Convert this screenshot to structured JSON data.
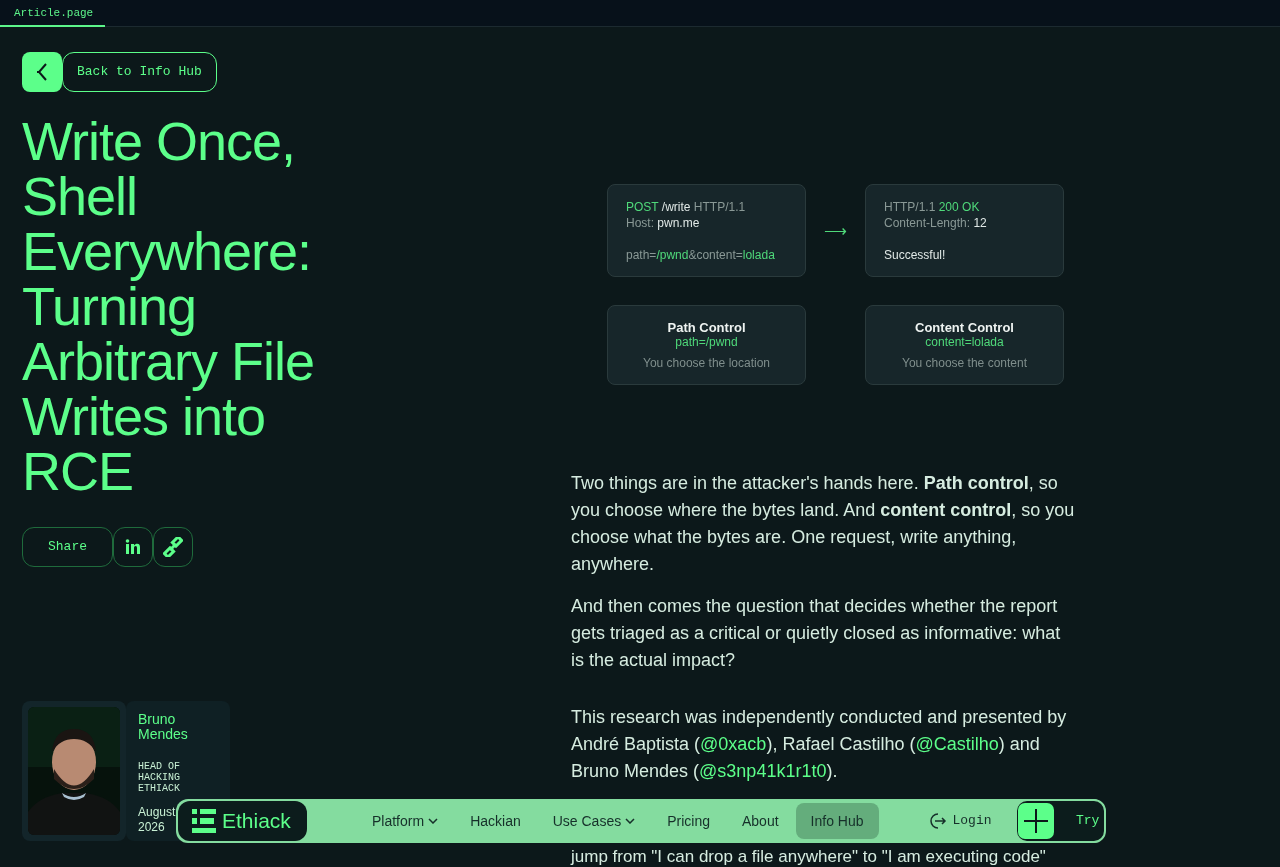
{
  "tabs": [
    {
      "label": "Article.page",
      "selected": true
    }
  ],
  "back_button": {
    "label": "Back to Info Hub"
  },
  "title": "Write Once, Shell Everywhere: Turning Arbitrary File Writes into RCE",
  "share": {
    "label": "Share"
  },
  "diagram": {
    "request": [
      [
        {
          "text": "POST ",
          "kind": "accent"
        },
        {
          "text": "/write ",
          "kind": "value"
        },
        {
          "text": "HTTP/1.1",
          "kind": "muted"
        }
      ],
      [
        {
          "text": "Host: ",
          "kind": "muted"
        },
        {
          "text": "pwn.me",
          "kind": "value"
        }
      ],
      [
        {
          "text": "path=",
          "kind": "muted"
        },
        {
          "text": "/pwnd",
          "kind": "accent"
        },
        {
          "text": "&content=",
          "kind": "muted"
        },
        {
          "text": "lolada",
          "kind": "accent"
        }
      ]
    ],
    "arrow": "⟶",
    "response": [
      [
        {
          "text": "HTTP/1.1 ",
          "kind": "muted"
        },
        {
          "text": "200 ",
          "kind": "accent"
        },
        {
          "text": "OK",
          "kind": "accent"
        }
      ],
      [
        {
          "text": "Content-Length: ",
          "kind": "muted"
        },
        {
          "text": "12",
          "kind": "value"
        }
      ],
      [
        {
          "text": "Successful!",
          "kind": "value"
        }
      ]
    ],
    "controls": [
      {
        "title": "Path Control",
        "param": "path=/pwnd",
        "caption": "You choose the location"
      },
      {
        "title": "Content Control",
        "param": "content=lolada",
        "caption": "You choose the content"
      }
    ]
  },
  "paragraphs": [
    [
      {
        "text": "Two things are in the attacker's hands here. **Path control**, so you choose where the bytes land. And **content control**, so you choose what the bytes are. One request, write anything, anywhere.",
        "kind": "text"
      }
    ],
    [
      {
        "text": "And then comes the question that decides whether the report gets triaged as a critical or quietly closed as informative: what is the actual impact?",
        "kind": "text"
      }
    ],
    [
      {
        "text": "This research was independently conducted and presented by André Baptista (",
        "kind": "text"
      },
      {
        "text": "@0xacb",
        "kind": "link"
      },
      {
        "text": "), Rafael Castilho (",
        "kind": "text"
      },
      {
        "text": "@Castilho",
        "kind": "link"
      },
      {
        "text": ") and Bruno Mendes (",
        "kind": "text"
      },
      {
        "text": "@s3np41k1r1t0",
        "kind": "link"
      },
      {
        "text": ").",
        "kind": "text"
      }
    ]
  ],
  "covered_paragraph": [
    "jump from \"I can drop a file anywhere\" to \"I am executing code\""
  ],
  "author": {
    "name": "Bruno Mendes",
    "role": "HEAD OF HACKING ETHIACK",
    "date": [
      "August",
      "2026"
    ]
  },
  "nav": {
    "logo": "Ethiack",
    "items": [
      {
        "label": "Platform",
        "dropdown": true,
        "selected": false
      },
      {
        "label": "Hackian",
        "dropdown": false,
        "selected": false
      },
      {
        "label": "Use Cases",
        "dropdown": true,
        "selected": false
      },
      {
        "label": "Pricing",
        "dropdown": false,
        "selected": false
      },
      {
        "label": "About",
        "dropdown": false,
        "selected": false
      },
      {
        "label": "Info Hub",
        "dropdown": false,
        "selected": true
      }
    ],
    "login": "Login",
    "try": "Try"
  }
}
